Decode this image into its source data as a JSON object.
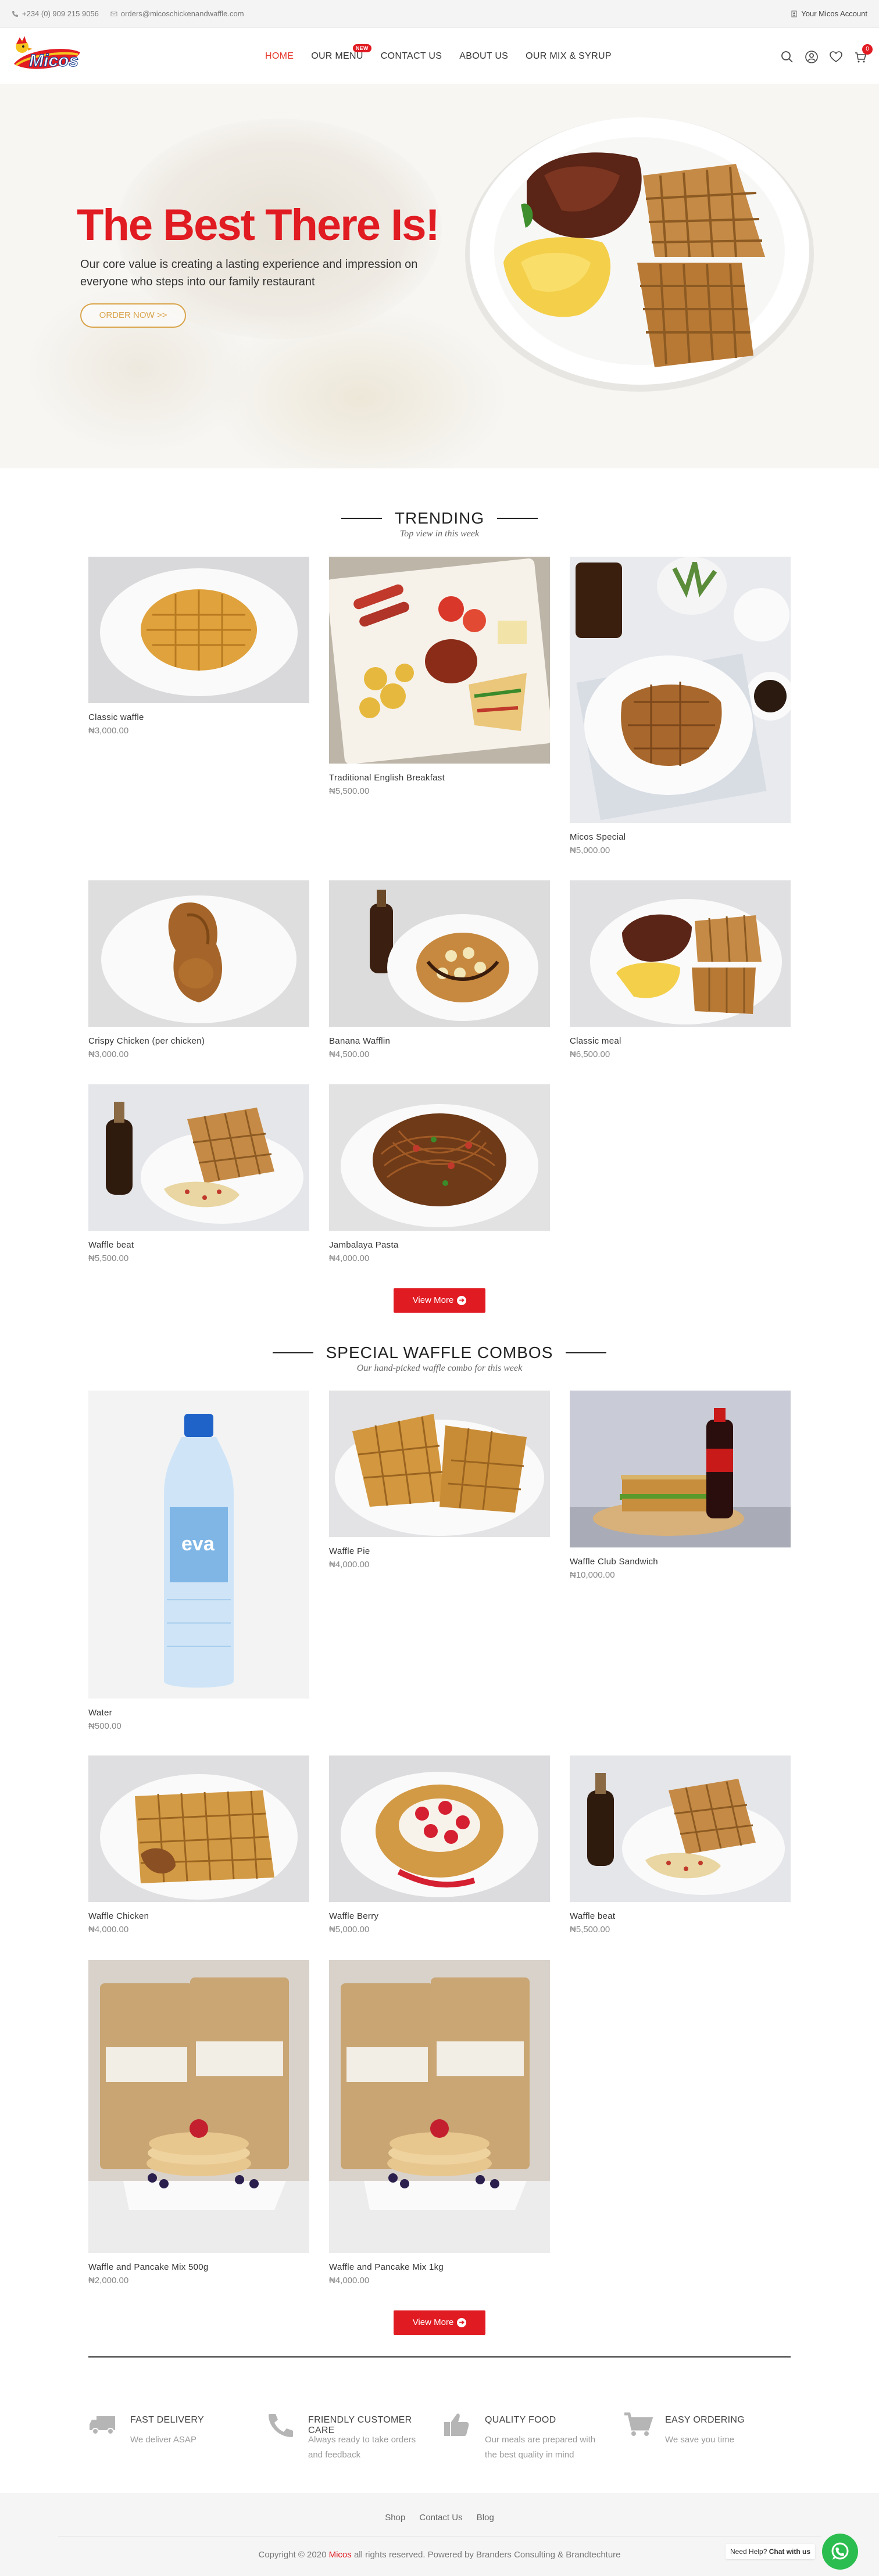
{
  "topbar": {
    "phone": "+234 (0) 909 215 9056",
    "email": "orders@micoschickenandwaffle.com",
    "account": "Your Micos Account"
  },
  "brand": {
    "logo_text": "Micos",
    "accent": "#e11b22",
    "gold": "#d9a44a"
  },
  "nav": {
    "items": [
      {
        "label": "HOME"
      },
      {
        "label": "OUR MENU"
      },
      {
        "label": "CONTACT US"
      },
      {
        "label": "ABOUT US"
      },
      {
        "label": "OUR MIX & SYRUP"
      }
    ],
    "new_badge": "NEW",
    "cart_count": "0"
  },
  "hero": {
    "title": "The Best There Is!",
    "subtitle": "Our core value is creating a lasting experience and impression on everyone who steps into our family restaurant",
    "cta": "ORDER NOW >>"
  },
  "trending": {
    "title": "TRENDING",
    "subtitle": "Top view in this week",
    "products": [
      {
        "name": "Classic waffle",
        "price": "₦3,000.00"
      },
      {
        "name": "Traditional English Breakfast",
        "price": "₦5,500.00"
      },
      {
        "name": "Micos Special",
        "price": "₦5,000.00"
      },
      {
        "name": "Crispy Chicken (per chicken)",
        "price": "₦3,000.00"
      },
      {
        "name": "Banana Wafflin",
        "price": "₦4,500.00"
      },
      {
        "name": "Classic meal",
        "price": "₦6,500.00"
      },
      {
        "name": "Waffle beat",
        "price": "₦5,500.00"
      },
      {
        "name": "Jambalaya Pasta",
        "price": "₦4,000.00"
      }
    ],
    "view_more": "View More"
  },
  "combos": {
    "title": "SPECIAL WAFFLE COMBOS",
    "subtitle": "Our hand-picked waffle combo for this week",
    "products": [
      {
        "name": "Water",
        "price": "₦500.00",
        "bottle_label": "eva"
      },
      {
        "name": "Waffle Pie",
        "price": "₦4,000.00"
      },
      {
        "name": "Waffle Club Sandwich",
        "price": "₦10,000.00"
      },
      {
        "name": "Waffle Chicken",
        "price": "₦4,000.00"
      },
      {
        "name": "Waffle Berry",
        "price": "₦5,000.00"
      },
      {
        "name": "Waffle beat",
        "price": "₦5,500.00"
      },
      {
        "name": "Waffle and Pancake Mix 500g",
        "price": "₦2,000.00"
      },
      {
        "name": "Waffle and Pancake Mix 1kg",
        "price": "₦4,000.00"
      }
    ],
    "view_more": "View More"
  },
  "features": [
    {
      "title": "FAST DELIVERY",
      "desc": "We deliver ASAP",
      "icon": "truck-icon"
    },
    {
      "title": "FRIENDLY CUSTOMER CARE",
      "desc": "Always ready to take orders and feedback",
      "icon": "phone-icon"
    },
    {
      "title": "QUALITY FOOD",
      "desc": "Our meals are prepared with the best quality in mind",
      "icon": "thumbs-up-icon"
    },
    {
      "title": "EASY ORDERING",
      "desc": "We save you time",
      "icon": "cart-icon"
    }
  ],
  "footer": {
    "links": [
      "Shop",
      "Contact Us",
      "Blog"
    ],
    "copyright_prefix": "Copyright © 2020",
    "copyright_brand": "Micos",
    "copyright_suffix": "all rights reserved. Powered by Branders Consulting & Brandtechture",
    "chat_prefix": "Need Help?",
    "chat_strong": "Chat with us"
  }
}
